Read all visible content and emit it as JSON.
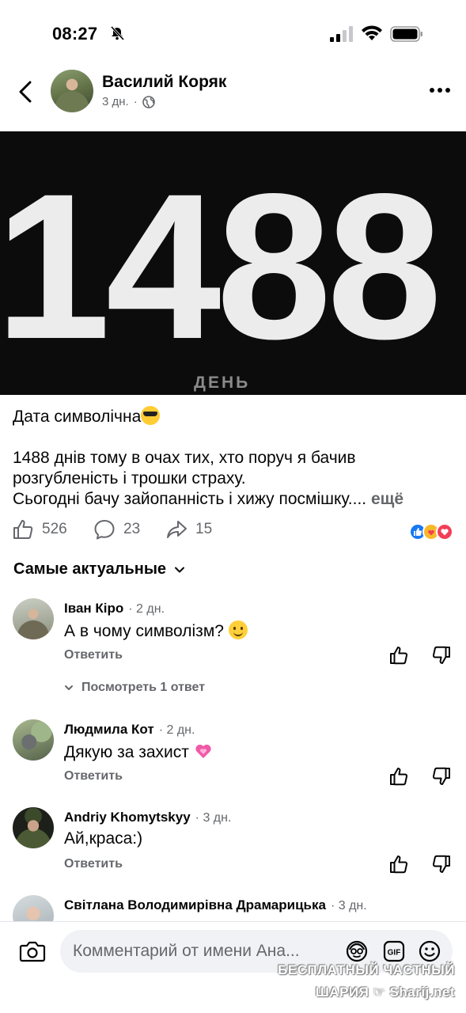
{
  "status_bar": {
    "time": "08:27"
  },
  "post": {
    "author": "Василий Коряк",
    "time": "3 дн.",
    "image": {
      "number": "1488",
      "caption": "ДЕНЬ"
    },
    "text": {
      "line1": "Дата символічна",
      "line2": "1488 днів тому в очах тих, хто поруч я бачив",
      "line3": "розгубленість і трошки страху.",
      "line4": "Сьогодні бачу зайопанність і хижу посмішку....",
      "see_more": "ещё"
    },
    "stats": {
      "likes": "526",
      "comments": "23",
      "shares": "15"
    },
    "colors": {
      "like_blue": "#1877f2",
      "love_red": "#f33e58",
      "care_yellow": "#f7b928"
    }
  },
  "sort": {
    "label": "Самые актуальные"
  },
  "comments": [
    {
      "name": "Іван Кіро",
      "time": "2 дн.",
      "text": "А в чому символізм?",
      "reply": "Ответить",
      "view_replies": "Посмотреть 1 ответ"
    },
    {
      "name": "Людмила Кот",
      "time": "2 дн.",
      "text": "Дякую за захист",
      "reply": "Ответить"
    },
    {
      "name": "Andriy Khomytskyy",
      "time": "3 дн.",
      "text": "Ай,краса:)",
      "reply": "Ответить"
    },
    {
      "name": "Світлана Володимирівна Драмарицька",
      "time": "3 дн."
    }
  ],
  "composer": {
    "placeholder": "Комментарий от имени Ана..."
  },
  "watermark": {
    "line1": "БЕСПЛАТНЫЙ ЧАСТНЫЙ",
    "line2": "ШАРИЯ",
    "line3": "Sharij.net"
  }
}
